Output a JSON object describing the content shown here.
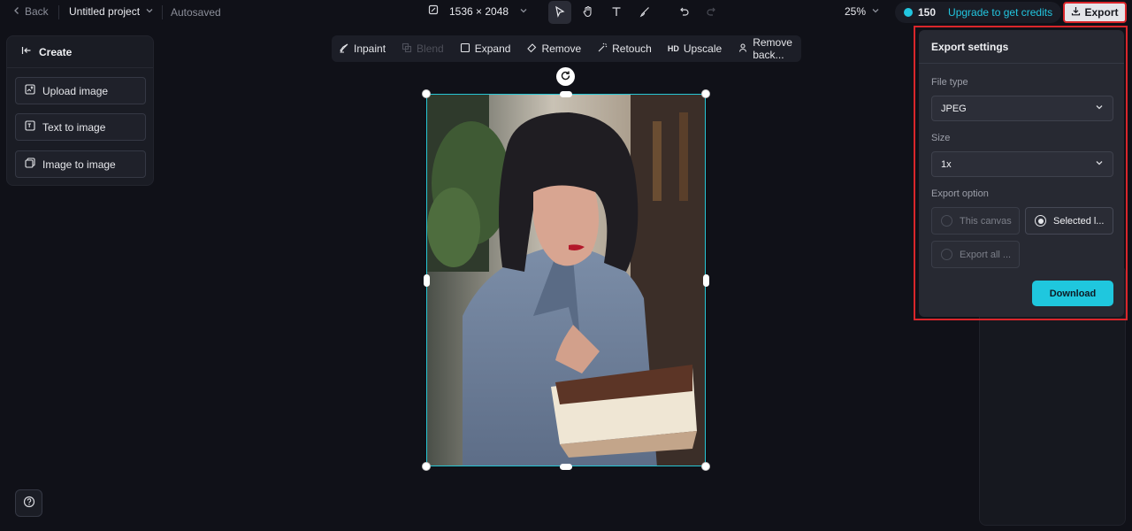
{
  "topbar": {
    "back_label": "Back",
    "project_title": "Untitled project",
    "autosaved": "Autosaved",
    "dimensions": "1536 × 2048",
    "zoom": "25%",
    "credits": "150",
    "upgrade_label": "Upgrade to get credits",
    "export_label": "Export"
  },
  "create_panel": {
    "title": "Create",
    "items": [
      {
        "label": "Upload image",
        "icon": "upload-image-icon"
      },
      {
        "label": "Text to image",
        "icon": "text-to-image-icon"
      },
      {
        "label": "Image to image",
        "icon": "image-to-image-icon"
      }
    ]
  },
  "image_toolbar": {
    "items": [
      {
        "label": "Inpaint",
        "enabled": true
      },
      {
        "label": "Blend",
        "enabled": false
      },
      {
        "label": "Expand",
        "enabled": true
      },
      {
        "label": "Remove",
        "enabled": true
      },
      {
        "label": "Retouch",
        "enabled": true
      },
      {
        "label": "Upscale",
        "enabled": true
      },
      {
        "label": "Remove back...",
        "enabled": true
      }
    ],
    "upscale_prefix": "HD"
  },
  "export_settings": {
    "title": "Export settings",
    "file_type_label": "File type",
    "file_type_value": "JPEG",
    "size_label": "Size",
    "size_value": "1x",
    "export_option_label": "Export option",
    "options": [
      {
        "label": "This canvas",
        "selected": false
      },
      {
        "label": "Selected l...",
        "selected": true
      },
      {
        "label": "Export all ...",
        "selected": false
      }
    ],
    "download_label": "Download"
  },
  "colors": {
    "accent": "#1fc7de",
    "highlight": "#d9262b",
    "background": "#101118"
  }
}
